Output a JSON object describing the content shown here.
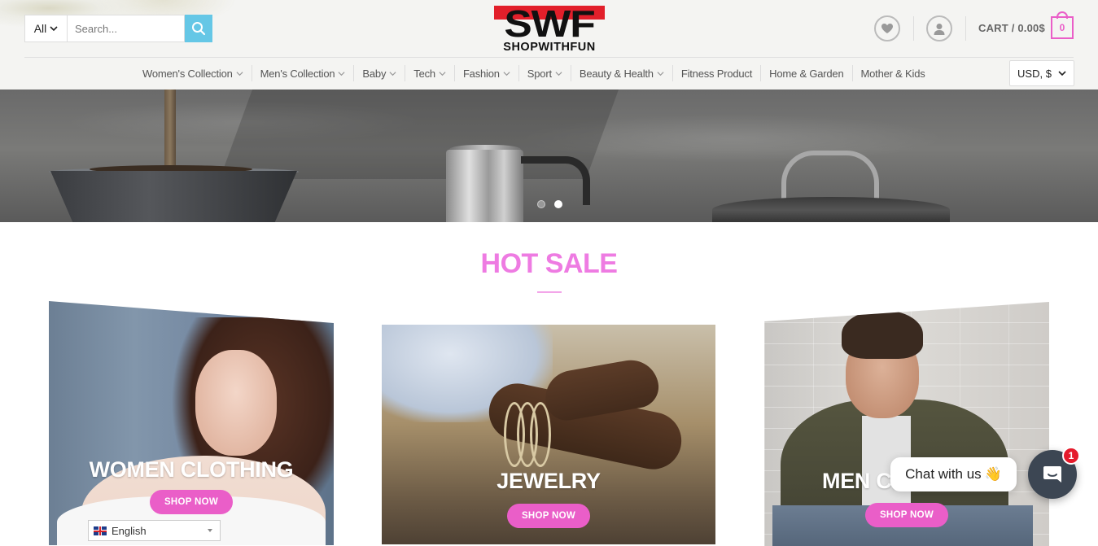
{
  "search": {
    "category": "All",
    "placeholder": "Search..."
  },
  "logo": {
    "mark": "SWF",
    "text": "SHOPWITHFUN"
  },
  "cart": {
    "label": "CART / 0.00$",
    "count": "0"
  },
  "nav": {
    "items": [
      {
        "label": "Women's Collection",
        "dropdown": true
      },
      {
        "label": "Men's Collection",
        "dropdown": true
      },
      {
        "label": "Baby",
        "dropdown": true
      },
      {
        "label": "Tech",
        "dropdown": true
      },
      {
        "label": "Fashion",
        "dropdown": true
      },
      {
        "label": "Sport",
        "dropdown": true
      },
      {
        "label": "Beauty & Health",
        "dropdown": true
      },
      {
        "label": "Fitness Product",
        "dropdown": false
      },
      {
        "label": "Home & Garden",
        "dropdown": false
      },
      {
        "label": "Mother & Kids",
        "dropdown": false
      }
    ],
    "currency": "USD, $"
  },
  "hero": {
    "slides": 2,
    "active_slide": 2
  },
  "hot_sale": {
    "title": "HOT SALE",
    "cards": [
      {
        "title": "WOMEN CLOTHING",
        "button": "SHOP NOW"
      },
      {
        "title": "JEWELRY",
        "button": "SHOP NOW"
      },
      {
        "title": "MEN CL",
        "button": "SHOP NOW"
      }
    ]
  },
  "language": {
    "label": "English"
  },
  "chat": {
    "label": "Chat with us",
    "emoji": "👋",
    "badge": "1"
  },
  "colors": {
    "accent_pink": "#ea5ec8",
    "title_pink": "#ee7be2",
    "search_blue": "#65c7e6",
    "brand_red": "#e21f2a",
    "chat_dark": "#3c4653",
    "badge_red": "#e51a2b"
  },
  "icons": {
    "search": "search-icon",
    "wishlist": "heart-icon",
    "account": "user-icon",
    "cart": "cart-bag-icon",
    "chat": "chat-icon",
    "flag": "uk-flag-icon"
  }
}
